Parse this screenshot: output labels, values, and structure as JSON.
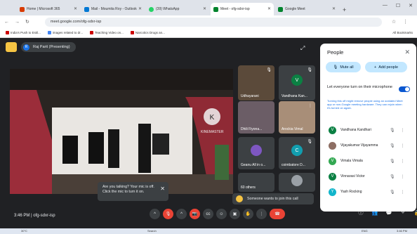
{
  "browser": {
    "tabs": [
      {
        "title": "Home | Microsoft 365",
        "color": "#d83b01"
      },
      {
        "title": "Mail - Moumita Roy - Outlook",
        "color": "#0078d4"
      },
      {
        "title": "(39) WhatsApp",
        "color": "#25d366"
      },
      {
        "title": "Meet - ofg-sdxr-isp",
        "color": "#00832d",
        "active": true
      },
      {
        "title": "Google Meet",
        "color": "#00832d"
      }
    ],
    "url": "meet.google.com/ofg-sdxr-isp",
    "bookmarks": [
      "India's Push to Estil...",
      "images related to dr...",
      "Teaching Video on...",
      "Narcotics Drugs an..."
    ],
    "all_bookmarks": "All Bookmarks"
  },
  "meet": {
    "presenter": "Raj Parit (Presenting)",
    "presenter_initial": "R",
    "time": "3:46 PM",
    "separator": "|",
    "code": "ofg-sdxr-isp",
    "tiles": [
      {
        "name": "Udhayarani",
        "bg": "#5b4a3a"
      },
      {
        "name": "Vandhana Kan...",
        "initial": "V",
        "avatar": "#0b8043"
      },
      {
        "name": "Dhili Fiyona...",
        "bg": "#6b5d66"
      },
      {
        "name": "Arockia Vimal",
        "bg": "#a88e78"
      },
      {
        "name": "Geanu All in o...",
        "initial": "",
        "avatar": "#7e57c2"
      },
      {
        "name": "coimbatore D...",
        "initial": "C",
        "avatar": "#129eaf"
      },
      {
        "name": "60 others",
        "bg": "#3c4043"
      }
    ],
    "toast": {
      "text": "Are you talking? Your mic is off. Click the mic to turn it on.",
      "close": "✕"
    },
    "join_text": "Someone wants to join this call",
    "main_video_watermark": "KINEMASTER"
  },
  "people_panel": {
    "title": "People",
    "close": "✕",
    "mute_all": "Mute all",
    "add_people": "Add people",
    "caption_title": "Let everyone turn on their microphone",
    "caption_sub": "Turning this off might remove people using an outdated Meet app or non-Google meeting hardware. They can rejoin when it's turned on again.",
    "participants": [
      {
        "name": "Vandhana Kandhari",
        "initial": "V",
        "color": "#0b8043"
      },
      {
        "name": "Vijayakumar Vijayamma",
        "initial": "",
        "color": "#8d6e63"
      },
      {
        "name": "Vimala Vimala",
        "initial": "V",
        "color": "#33a852"
      },
      {
        "name": "Vinnarasi Victor",
        "initial": "V",
        "color": "#0b8043"
      },
      {
        "name": "Yash Rocking",
        "initial": "Y",
        "color": "#12b5cb"
      }
    ]
  },
  "taskbar": {
    "temp": "30°C",
    "search": "Search",
    "lang": "ENG",
    "time": "3:46 PM"
  }
}
